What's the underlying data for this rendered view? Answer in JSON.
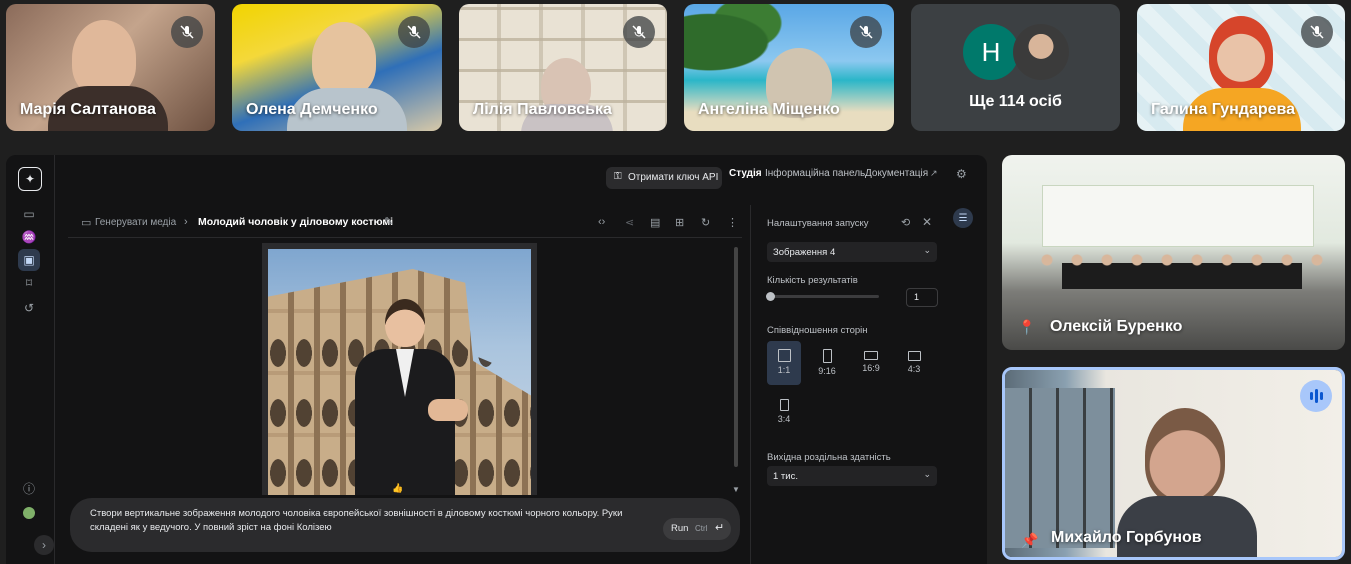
{
  "participants": [
    {
      "name": "Марія Салтанова",
      "muted": true
    },
    {
      "name": "Олена Демченко",
      "muted": true
    },
    {
      "name": "Лілія Павловська",
      "muted": true
    },
    {
      "name": "Ангеліна Міщенко",
      "muted": true
    },
    {
      "name": "Галина Гундарева",
      "muted": true
    }
  ],
  "more_tile": {
    "avatar_letter": "H",
    "label": "Ще 114 осіб"
  },
  "side_tiles": [
    {
      "name": "Олексій Буренко"
    },
    {
      "name": "Михайло Горбунов"
    }
  ],
  "studio": {
    "topbar": {
      "api_key_button": "Отримати ключ API",
      "studio_tab": "Студія",
      "dashboard_tab": "Інформаційна панель",
      "docs_link": "Документація"
    },
    "breadcrumb": {
      "root": "Генерувати медіа",
      "current": "Молодий чоловік у діловому костюмі"
    },
    "prompt": {
      "text": "Створи вертикальне зображення молодого чоловіка європейської зовнішності в діловому костюмі чорного кольору. Руки складені як у ведучого. У повний зріст на фоні Колізею",
      "run_label": "Run",
      "shortcut": "Ctrl"
    },
    "settings": {
      "title": "Налаштування запуску",
      "model": "Зображення 4",
      "results_label": "Кількість результатів",
      "results_value": "1",
      "aspect_label": "Співвідношення сторін",
      "aspect_options": [
        "1:1",
        "9:16",
        "16:9",
        "4:3",
        "3:4"
      ],
      "aspect_selected": "1:1",
      "resolution_label": "Вихідна роздільна здатність",
      "resolution_value": "1 тис."
    }
  },
  "colors": {
    "page_bg": "#1f1f1f",
    "studio_bg": "#131314",
    "active_speaker_border": "#a8c7fa",
    "avatar_teal": "#00796b"
  }
}
